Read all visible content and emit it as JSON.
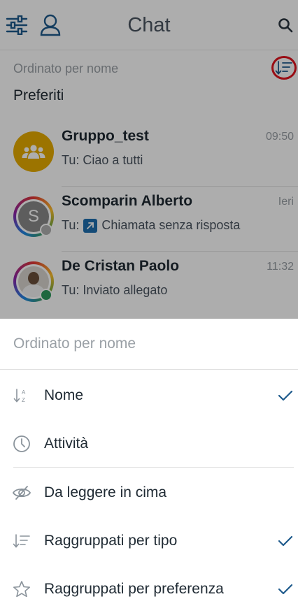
{
  "header": {
    "title": "Chat"
  },
  "list": {
    "sort_label": "Ordinato per nome",
    "section_title": "Preferiti",
    "chats": [
      {
        "name": "Gruppo_test",
        "time": "09:50",
        "message": "Tu: Ciao a tutti",
        "avatar_initial": ""
      },
      {
        "name": "Scomparin Alberto",
        "time": "Ieri",
        "message_prefix": "Tu:",
        "message": "Chiamata senza risposta",
        "avatar_initial": "S"
      },
      {
        "name": "De Cristan Paolo",
        "time": "11:32",
        "message": "Tu: Inviato allegato",
        "avatar_initial": ""
      }
    ]
  },
  "sheet": {
    "title": "Ordinato per nome",
    "options": [
      {
        "label": "Nome",
        "icon": "sort-alpha-icon",
        "checked": true
      },
      {
        "label": "Attività",
        "icon": "clock-icon",
        "checked": false
      },
      {
        "label": "Da leggere in cima",
        "icon": "eye-icon",
        "checked": false
      },
      {
        "label": "Raggruppati per tipo",
        "icon": "sort-list-icon",
        "checked": true
      },
      {
        "label": "Raggruppati per preferenza",
        "icon": "star-icon",
        "checked": true
      }
    ]
  },
  "colors": {
    "accent": "#1e5a8c",
    "group_avatar": "#e6ab00",
    "highlight": "#e2141e",
    "online": "#2e9a5e"
  }
}
